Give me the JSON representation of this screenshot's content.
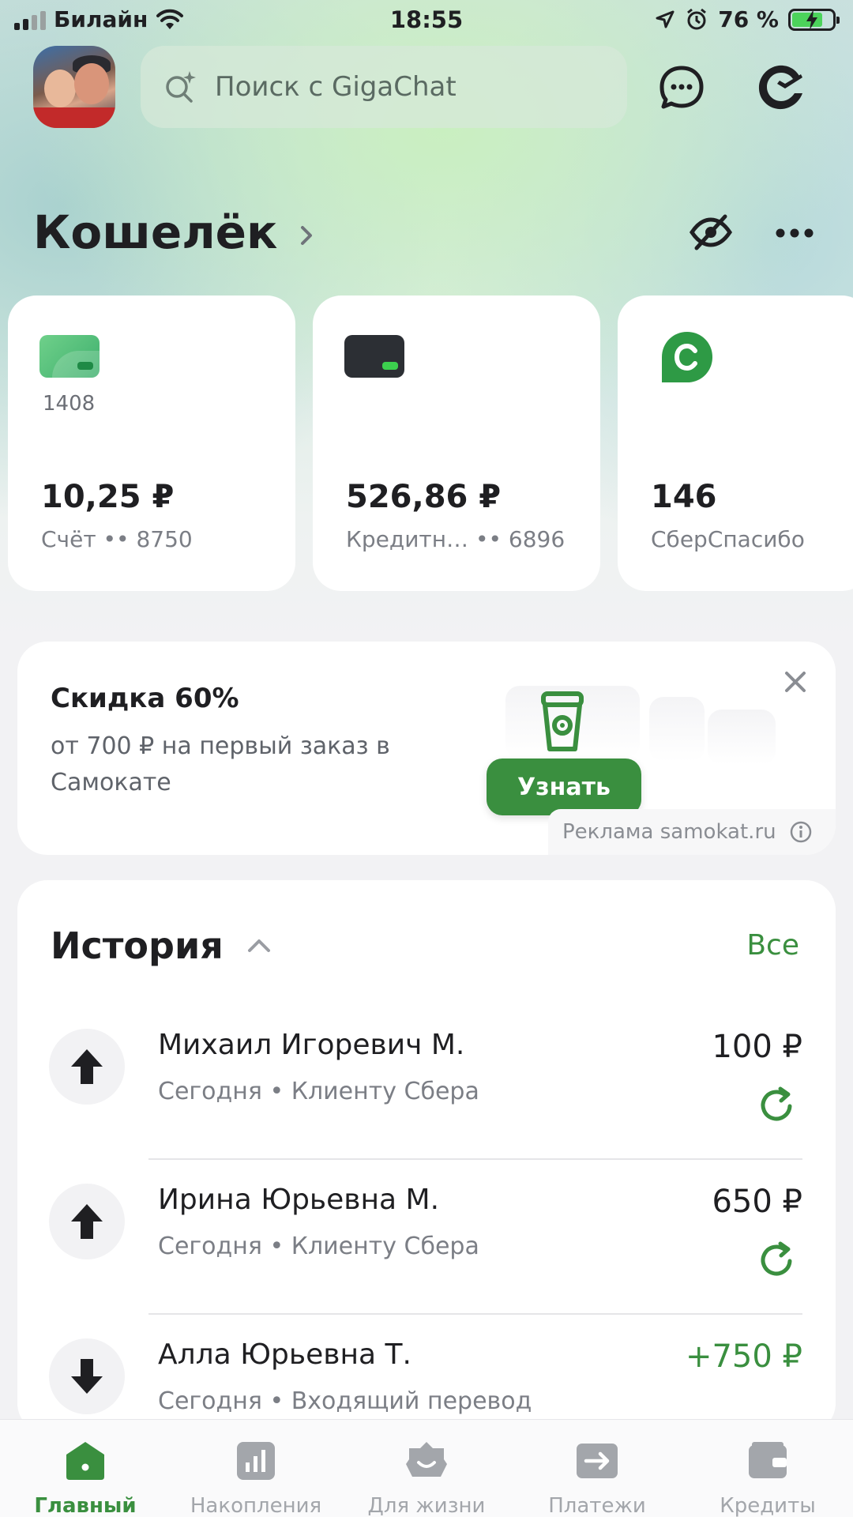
{
  "status_bar": {
    "carrier": "Билайн",
    "time": "18:55",
    "battery_percent": "76 %",
    "battery_level": 0.76
  },
  "header": {
    "search_placeholder": "Поиск с GigaChat"
  },
  "wallet": {
    "title": "Кошелёк",
    "cards": [
      {
        "number": "1408",
        "amount": "10,25 ₽",
        "label": "Счёт •• 8750"
      },
      {
        "number": "",
        "amount": "526,86 ₽",
        "label": "Кредитн… •• 6896"
      },
      {
        "number": "",
        "amount": "146",
        "label": "СберСпасибо"
      }
    ]
  },
  "promo": {
    "title": "Скидка 60%",
    "text": "от 700 ₽ на первый заказ в Самокате",
    "button": "Узнать",
    "ad_label": "Реклама samokat.ru"
  },
  "history": {
    "title": "История",
    "all_link": "Все",
    "items": [
      {
        "name": "Михаил Игоревич М.",
        "desc": "Сегодня • Клиенту Сбера",
        "amount": "100 ₽",
        "direction": "out"
      },
      {
        "name": "Ирина Юрьевна М.",
        "desc": "Сегодня • Клиенту Сбера",
        "amount": "650 ₽",
        "direction": "out"
      },
      {
        "name": "Алла Юрьевна Т.",
        "desc": "Сегодня • Входящий перевод",
        "amount": "+750 ₽",
        "direction": "in"
      }
    ]
  },
  "tabbar": {
    "tabs": [
      {
        "label": "Главный",
        "icon": "home-icon",
        "active": true
      },
      {
        "label": "Накопления",
        "icon": "savings-chart-icon",
        "active": false
      },
      {
        "label": "Для жизни",
        "icon": "life-icon",
        "active": false
      },
      {
        "label": "Платежи",
        "icon": "payments-arrow-icon",
        "active": false
      },
      {
        "label": "Кредиты",
        "icon": "wallet-icon",
        "active": false
      }
    ]
  },
  "colors": {
    "accent": "#3a8f3f",
    "card_green": "#3fb06e",
    "card_dark": "#2c2f34"
  }
}
